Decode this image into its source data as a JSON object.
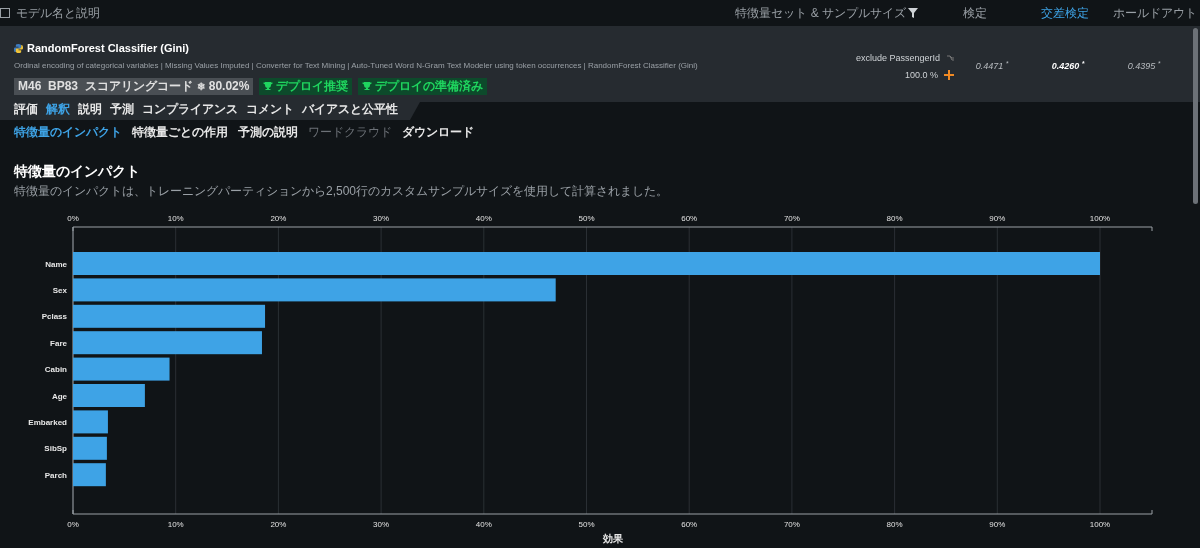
{
  "header": {
    "checkbox": {
      "label": "モデル名と説明",
      "checked": false
    },
    "columns": [
      {
        "label": "特徴量セット & サンプルサイズ",
        "kind": "filter",
        "selected": false
      },
      {
        "label": "検定",
        "kind": "plain",
        "selected": false
      },
      {
        "label": "交差検定",
        "kind": "plain",
        "selected": true
      },
      {
        "label": "ホールドアウト",
        "kind": "plain",
        "selected": false
      }
    ]
  },
  "model": {
    "name": "RandomForest Classifier (Gini)",
    "description": "Ordinal encoding of categorical variables | Missing Values Imputed | Converter for Text Mining | Auto-Tuned Word N-Gram Text Modeler using token occurrences | RandomForest Classifier (Gini)",
    "badges": [
      {
        "text": "M46  BP83  スコアリングコード",
        "kind": "info",
        "icon": "❄",
        "extra": "80.02%"
      },
      {
        "text": "デプロイ推奨",
        "kind": "deploy"
      },
      {
        "text": "デプロイの準備済み",
        "kind": "deploy"
      }
    ],
    "feature_set": "exclude PassengerId",
    "sample_size": "100.0 %",
    "scores": [
      {
        "value": "0.4471",
        "mark": "*",
        "selected": false
      },
      {
        "value": "0.4260",
        "mark": "*",
        "selected": true
      },
      {
        "value": "0.4395",
        "mark": "*",
        "selected": false
      }
    ]
  },
  "tabs": [
    {
      "label": "評価",
      "selected": false
    },
    {
      "label": "解釈",
      "selected": true
    },
    {
      "label": "説明",
      "selected": false
    },
    {
      "label": "予測",
      "selected": false
    },
    {
      "label": "コンプライアンス",
      "selected": false
    },
    {
      "label": "コメント",
      "selected": false
    },
    {
      "label": "バイアスと公平性",
      "selected": false
    }
  ],
  "subtabs": [
    {
      "label": "特徴量のインパクト",
      "selected": true,
      "disabled": false
    },
    {
      "label": "特徴量ごとの作用",
      "selected": false,
      "disabled": false
    },
    {
      "label": "予測の説明",
      "selected": false,
      "disabled": false
    },
    {
      "label": "ワードクラウド",
      "selected": false,
      "disabled": true
    },
    {
      "label": "ダウンロード",
      "selected": false,
      "disabled": false
    }
  ],
  "section": {
    "title": "特徴量のインパクト",
    "subtitle": "特徴量のインパクトは、トレーニングパーティションから2,500行のカスタムサンプルサイズを使用して計算されました。",
    "chart_data": {
      "type": "bar",
      "orientation": "horizontal",
      "xlabel": "効果",
      "categories": [
        "Name",
        "Sex",
        "Pclass",
        "Fare",
        "Cabin",
        "Age",
        "Embarked",
        "SibSp",
        "Parch"
      ],
      "values": [
        100,
        47,
        18.7,
        18.4,
        9.4,
        7,
        3.4,
        3.3,
        3.2
      ],
      "grid": true,
      "xlim": [
        0,
        100
      ],
      "xticks": [
        {
          "value": 0,
          "label": "0%"
        },
        {
          "value": 10,
          "label": "10%"
        },
        {
          "value": 20,
          "label": "20%"
        },
        {
          "value": 30,
          "label": "30%"
        },
        {
          "value": 40,
          "label": "40%"
        },
        {
          "value": 50,
          "label": "50%"
        },
        {
          "value": 60,
          "label": "60%"
        },
        {
          "value": 70,
          "label": "70%"
        },
        {
          "value": 80,
          "label": "80%"
        },
        {
          "value": 90,
          "label": "90%"
        },
        {
          "value": 100,
          "label": "100%"
        }
      ]
    }
  }
}
